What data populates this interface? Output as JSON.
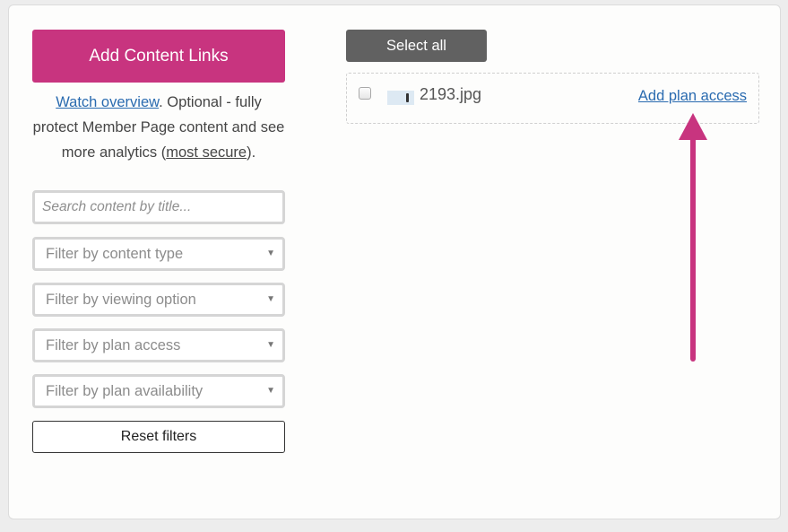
{
  "sidebar": {
    "add_button_label": "Add Content Links",
    "overview_link": "Watch overview",
    "overview_text_1": ".  Optional - fully protect Member Page content and see more analytics (",
    "most_secure_link": "most secure",
    "overview_text_2": ").",
    "search_placeholder": "Search content by title...",
    "filters": [
      {
        "label": "Filter by content type"
      },
      {
        "label": "Filter by viewing option"
      },
      {
        "label": "Filter by plan access"
      },
      {
        "label": "Filter by plan availability"
      }
    ],
    "reset_label": "Reset filters"
  },
  "main": {
    "select_all_label": "Select all",
    "items": [
      {
        "filename": "2193.jpg",
        "action_label": "Add plan access",
        "checked": false
      }
    ]
  },
  "colors": {
    "primary_button": "#c8347f",
    "link": "#2a6bb0",
    "select_all_button": "#616161",
    "annotation_arrow": "#c8347f"
  },
  "icons": {
    "filter_chevron": "chevron-down-icon",
    "annotation": "arrow-up-icon"
  }
}
